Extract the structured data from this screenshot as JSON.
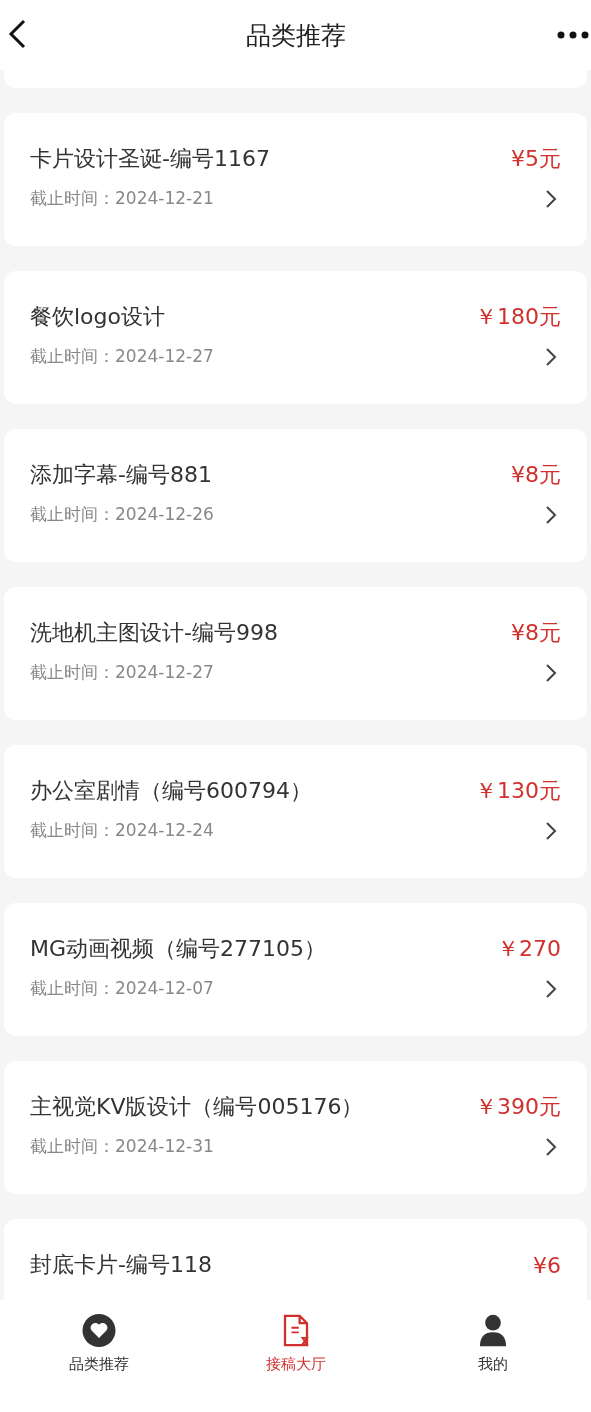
{
  "header": {
    "title": "品类推荐"
  },
  "tasks": [
    {
      "title": "卡片设计圣诞-编号1167",
      "price": "¥5元",
      "deadline": "截止时间：2024-12-21"
    },
    {
      "title": "餐饮logo设计",
      "price": "￥180元",
      "deadline": "截止时间：2024-12-27"
    },
    {
      "title": "添加字幕-编号881",
      "price": "¥8元",
      "deadline": "截止时间：2024-12-26"
    },
    {
      "title": "洗地机主图设计-编号998",
      "price": "¥8元",
      "deadline": "截止时间：2024-12-27"
    },
    {
      "title": "办公室剧情（编号600794）",
      "price": "￥130元",
      "deadline": "截止时间：2024-12-24"
    },
    {
      "title": "MG动画视频（编号277105）",
      "price": "￥270",
      "deadline": "截止时间：2024-12-07"
    },
    {
      "title": "主视觉KV版设计（编号005176）",
      "price": "￥390元",
      "deadline": "截止时间：2024-12-31"
    },
    {
      "title": "封底卡片-编号118",
      "price": "¥6"
    }
  ],
  "tab_bar": [
    {
      "label": "品类推荐",
      "kind": "heart",
      "selected": false
    },
    {
      "label": "接稿大厅",
      "kind": "document",
      "selected": true
    },
    {
      "label": "我的",
      "kind": "person",
      "selected": false
    }
  ]
}
